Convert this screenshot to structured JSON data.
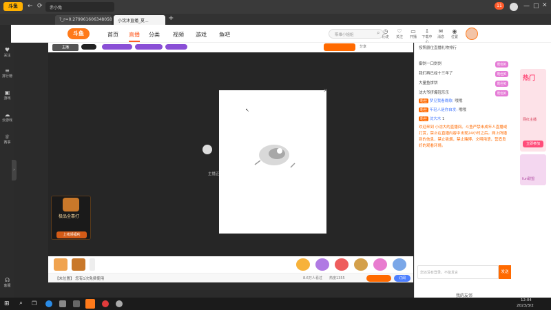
{
  "browser": {
    "tab_search_label": "赤小兔",
    "url_text": "?_r=0.27996160634805856",
    "active_tab_label": "小沈沐直播_夏...",
    "new_tab_glyph": "+",
    "notification_count": "11"
  },
  "site": {
    "logo_text": "斗鱼",
    "nav": [
      "首页",
      "直播",
      "分类",
      "视频",
      "游戏",
      "鱼吧"
    ],
    "search_placeholder": "斯维小姐姐",
    "header_icons": [
      {
        "label": "历史",
        "icon": "clock-icon"
      },
      {
        "label": "关注",
        "icon": "heart-icon"
      },
      {
        "label": "开播",
        "icon": "broadcast-icon"
      },
      {
        "label": "下载中心",
        "icon": "download-icon"
      },
      {
        "label": "消息",
        "icon": "bell-icon"
      },
      {
        "label": "位置",
        "icon": "location-icon"
      }
    ]
  },
  "sidebar": {
    "items": [
      {
        "label": "关注",
        "icon": "heart-icon"
      },
      {
        "label": "排行榜",
        "icon": "rank-icon"
      },
      {
        "label": "游戏",
        "icon": "gamepad-icon"
      },
      {
        "label": "云游戏",
        "icon": "cloud-game-icon"
      },
      {
        "label": "赛事",
        "icon": "trophy-icon"
      },
      {
        "label": "客服",
        "icon": "headset-icon"
      }
    ]
  },
  "stream": {
    "tags": [
      "主播",
      "主播"
    ],
    "promo_text": "极品全靠打",
    "promo_btn": "上线领福利",
    "center_label": "主播正"
  },
  "right_panel": {
    "rank_title": "按照爵位直播礼物排行",
    "rank_rows": [
      {
        "name": "御剑一口剑剑",
        "tag": "粉丝6"
      },
      {
        "name": "我们再已经十三年了",
        "tag": "粉丝6"
      },
      {
        "name": "大量鱼饼饼",
        "tag": "粉丝6"
      },
      {
        "name": "沈大爷挤爆冠乐乐",
        "tag": "粉丝6"
      }
    ],
    "chat": [
      {
        "badge": "粉丝",
        "user": "梦见我看晚歌:",
        "msg": "哦哦"
      },
      {
        "badge": "粉丝",
        "user": "年轻人是你自发:",
        "msg": "哦哦"
      },
      {
        "badge": "粉丝",
        "user": "沈大木",
        "msg": "1"
      }
    ],
    "notice": "欢迎来到 小沈大的直播间。斗鱼严禁未成年人直播或打赏，禁止在直播内容中出现24小时之后。网上所播到的信息，禁止吸烟，禁止赌博。文明用语，营造良好的观看环境。",
    "input_placeholder": "您还没有登录，不能发言",
    "send_label": "发送",
    "footer": [
      "我的友邻",
      "我的排行"
    ]
  },
  "tools": {
    "notice_text": "【未位置】 您有1次免费使用",
    "stats": [
      "8.6万人看过",
      "热度1355",
      "关注",
      "你的粉丝"
    ],
    "follow_label": "订阅",
    "share_label": "分享"
  },
  "ads": {
    "top": "热门",
    "sub": "网红主播",
    "btn": "立即参加",
    "mini": "fun联盟"
  },
  "taskbar": {
    "time": "12:04",
    "date": "2023/3/2"
  }
}
